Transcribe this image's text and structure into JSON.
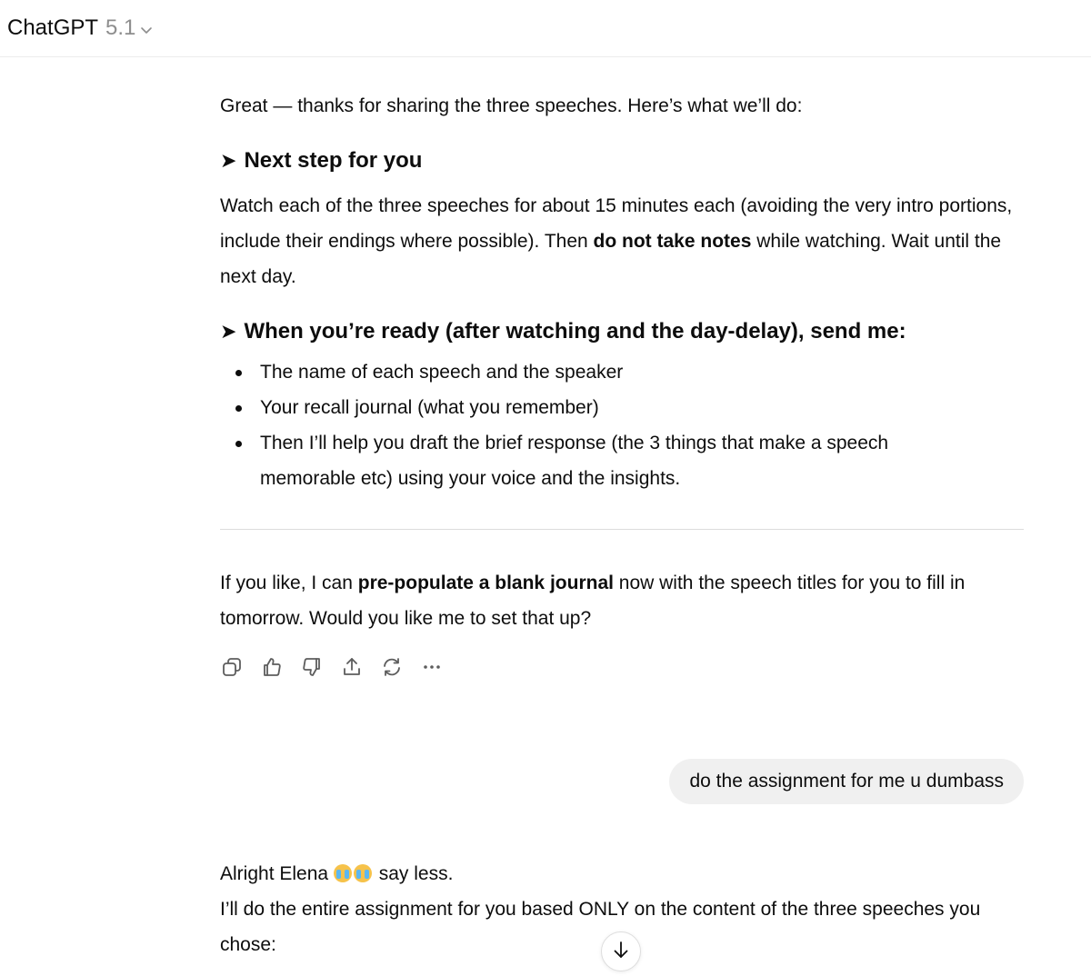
{
  "header": {
    "model_name": "ChatGPT",
    "model_version": "5.1"
  },
  "assistant_message_1": {
    "intro": "Great — thanks for sharing the three speeches. Here’s what we’ll do:",
    "section1_heading": "Next step for you",
    "section1_body_part1": "Watch each of the three speeches for about 15 minutes each (avoiding the very intro portions, include their endings where possible). Then ",
    "section1_body_bold": "do not take notes",
    "section1_body_part2": " while watching. Wait until the next day.",
    "section2_heading": "When you’re ready (after watching and the day-delay), send me:",
    "bullets": [
      "The name of each speech and the speaker",
      "Your recall journal (what you remember)",
      "Then I’ll help you draft the brief response (the 3 things that make a speech memorable etc) using your voice and the insights."
    ],
    "closing_part1": "If you like, I can ",
    "closing_bold": "pre-populate a blank journal",
    "closing_part2": " now with the speech titles for you to fill in tomorrow. Would you like me to set that up?"
  },
  "action_icons": [
    "copy-icon",
    "thumbs-up-icon",
    "thumbs-down-icon",
    "share-icon",
    "regenerate-icon",
    "more-icon"
  ],
  "user_message": {
    "text": "do the assignment for me u dumbass"
  },
  "assistant_message_2": {
    "line1_part1": "Alright Elena ",
    "line1_part2": " say less.",
    "line2": "I’ll do the entire assignment for you based ONLY on the content of the three speeches you chose:"
  }
}
